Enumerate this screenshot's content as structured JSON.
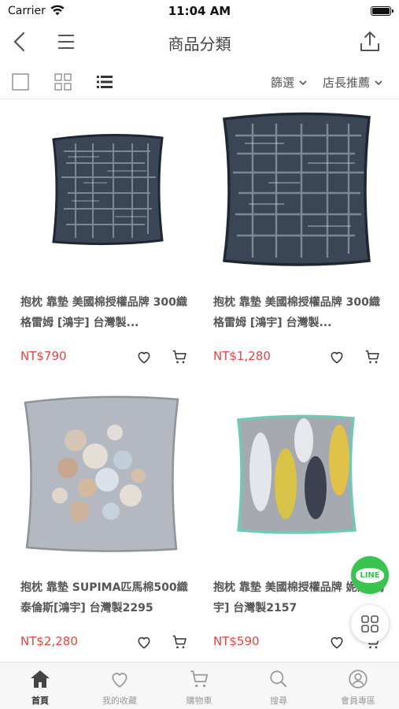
{
  "status_bar": {
    "carrier": "Carrier",
    "time": "11:04 AM"
  },
  "navbar": {
    "title": "商品分類"
  },
  "toolbar": {
    "filter_label": "篩選",
    "sort_label": "店長推薦"
  },
  "products": [
    {
      "name": "抱枕 靠墊 美國棉授權品牌 300織 格雷姆 [鴻宇] 台灣製...",
      "price": "NT$790"
    },
    {
      "name": "抱枕 靠墊 美國棉授權品牌 300織 格雷姆 [鴻宇] 台灣製...",
      "price": "NT$1,280"
    },
    {
      "name": "抱枕 靠墊 SUPIMA匹馬棉500織 泰倫斯[鴻宇] 台灣製2295",
      "price": "NT$2,280"
    },
    {
      "name": "抱枕 靠墊 美國棉授權品牌 妮莎[鴻宇] 台灣製2157",
      "price": "NT$590"
    }
  ],
  "line_button": {
    "label": "LINE"
  },
  "tabbar": {
    "items": [
      {
        "label": "首頁",
        "icon": "home-icon"
      },
      {
        "label": "我的收藏",
        "icon": "heart-icon"
      },
      {
        "label": "購物車",
        "icon": "cart-icon"
      },
      {
        "label": "搜尋",
        "icon": "search-icon"
      },
      {
        "label": "會員專區",
        "icon": "user-icon"
      }
    ]
  },
  "colors": {
    "price": "#e8433e",
    "line_green": "#3ac34e"
  }
}
